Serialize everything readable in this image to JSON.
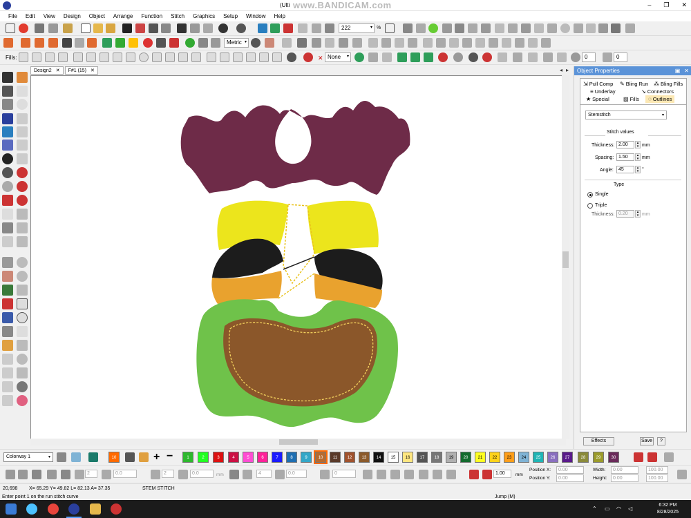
{
  "window": {
    "title": "(Ulti",
    "watermark": "www.BANDICAM.com",
    "minimize": "–",
    "restore": "❐",
    "close": "✕"
  },
  "menu": [
    "File",
    "Edit",
    "View",
    "Design",
    "Object",
    "Arrange",
    "Function",
    "Stitch",
    "Graphics",
    "Setup",
    "Window",
    "Help"
  ],
  "toolbar": {
    "zoom_value": "222",
    "zoom_unit": "%",
    "units": "Metric",
    "fills_label": "Fills:",
    "fill_none": "None",
    "stitch_count_field": "0"
  },
  "tabs": {
    "design2": "Design2",
    "f1": "F#1 (15)",
    "close_glyph": "✕",
    "nav_left": "◂",
    "nav_right": "▸"
  },
  "panel": {
    "title": "Object Properties",
    "pin": "▣",
    "close": "✕",
    "tabs": [
      "Pull Comp",
      "Bling Run",
      "Bling Fills",
      "Underlay",
      "Connectors",
      "Special",
      "Fills",
      "Outlines"
    ],
    "active_tab": "Outlines",
    "stitch_type": "Stemstitch",
    "stitch_values_heading": "Stitch values",
    "thickness_label": "Thickness:",
    "thickness_value": "2.00",
    "spacing_label": "Spacing:",
    "spacing_value": "1.50",
    "angle_label": "Angle:",
    "angle_value": "45",
    "mm": "mm",
    "degree": "°",
    "type_heading": "Type",
    "single_label": "Single",
    "triple_label": "Triple",
    "triple_thickness_label": "Thickness:",
    "triple_thickness_value": "0.20",
    "selected_type": "Single",
    "effects_button": "Effects",
    "save_button": "Save",
    "help_button": "?"
  },
  "colorway": {
    "label": "Colorway 1"
  },
  "palette": [
    {
      "n": "1",
      "color": "#2eb82e",
      "dark": false
    },
    {
      "n": "2",
      "color": "#22ff22",
      "dark": false
    },
    {
      "n": "3",
      "color": "#dd1111",
      "dark": false
    },
    {
      "n": "4",
      "color": "#cc1144",
      "dark": false
    },
    {
      "n": "5",
      "color": "#ff4dd2",
      "dark": false
    },
    {
      "n": "6",
      "color": "#ff2299",
      "dark": false
    },
    {
      "n": "7",
      "color": "#1a1aff",
      "dark": false
    },
    {
      "n": "8",
      "color": "#1f6fb2",
      "dark": false
    },
    {
      "n": "9",
      "color": "#33a7c8",
      "dark": false
    },
    {
      "n": "10",
      "color": "#b86b2e",
      "dark": false,
      "selected": true
    },
    {
      "n": "11",
      "color": "#5a3a2a",
      "dark": false
    },
    {
      "n": "12",
      "color": "#a0522d",
      "dark": false
    },
    {
      "n": "13",
      "color": "#8b5a2b",
      "dark": false
    },
    {
      "n": "14",
      "color": "#111111",
      "dark": false
    },
    {
      "n": "15",
      "color": "#ffffff",
      "dark": true
    },
    {
      "n": "16",
      "color": "#ffe680",
      "dark": true
    },
    {
      "n": "17",
      "color": "#555555",
      "dark": false
    },
    {
      "n": "18",
      "color": "#777777",
      "dark": false
    },
    {
      "n": "19",
      "color": "#b0b0b0",
      "dark": true
    },
    {
      "n": "20",
      "color": "#146b2e",
      "dark": false
    },
    {
      "n": "21",
      "color": "#ffff22",
      "dark": true
    },
    {
      "n": "22",
      "color": "#ffd21a",
      "dark": true
    },
    {
      "n": "23",
      "color": "#ff9e1a",
      "dark": true
    },
    {
      "n": "24",
      "color": "#7fb3d5",
      "dark": true
    },
    {
      "n": "25",
      "color": "#1fb5b5",
      "dark": false
    },
    {
      "n": "26",
      "color": "#8a6fbf",
      "dark": false
    },
    {
      "n": "27",
      "color": "#5a1a8b",
      "dark": false
    },
    {
      "n": "28",
      "color": "#8b8b3a",
      "dark": false
    },
    {
      "n": "29",
      "color": "#9b9b2a",
      "dark": false
    },
    {
      "n": "30",
      "color": "#6a2a5a",
      "dark": false
    }
  ],
  "current_color": {
    "n": "10",
    "color": "#ff6a00"
  },
  "propbar": {
    "position_x_label": "Position X:",
    "position_y_label": "Position Y:",
    "width_label": "Width:",
    "height_label": "Height:",
    "position_x": "0.00",
    "position_y": "0.00",
    "width": "0.00",
    "height": "0.00",
    "width_pct": "100.00",
    "height_pct": "100.00",
    "spacing_value": "1.00",
    "mm": "mm",
    "zero_fields": [
      "2",
      "0.0",
      "2",
      "0.0",
      "4",
      "0.0",
      "0"
    ]
  },
  "status": {
    "stitch_count": "20,698",
    "coords": "X= 65.29 Y= 49.82 L= 82.13 A= 37.35",
    "stitch_type": "STEM STITCH",
    "jump": "Jump (M)",
    "prompt": "Enter point 1 on the run stitch curve"
  },
  "taskbar": {
    "time": "6:32 PM",
    "date": "8/28/2025"
  },
  "colors": {
    "maroon": "#6e2b48",
    "yellow": "#ece51c",
    "black": "#1c1c1c",
    "orange": "#e9a22e",
    "green": "#6fc24a",
    "brown": "#8b572a",
    "accent": "#5b93d8"
  }
}
